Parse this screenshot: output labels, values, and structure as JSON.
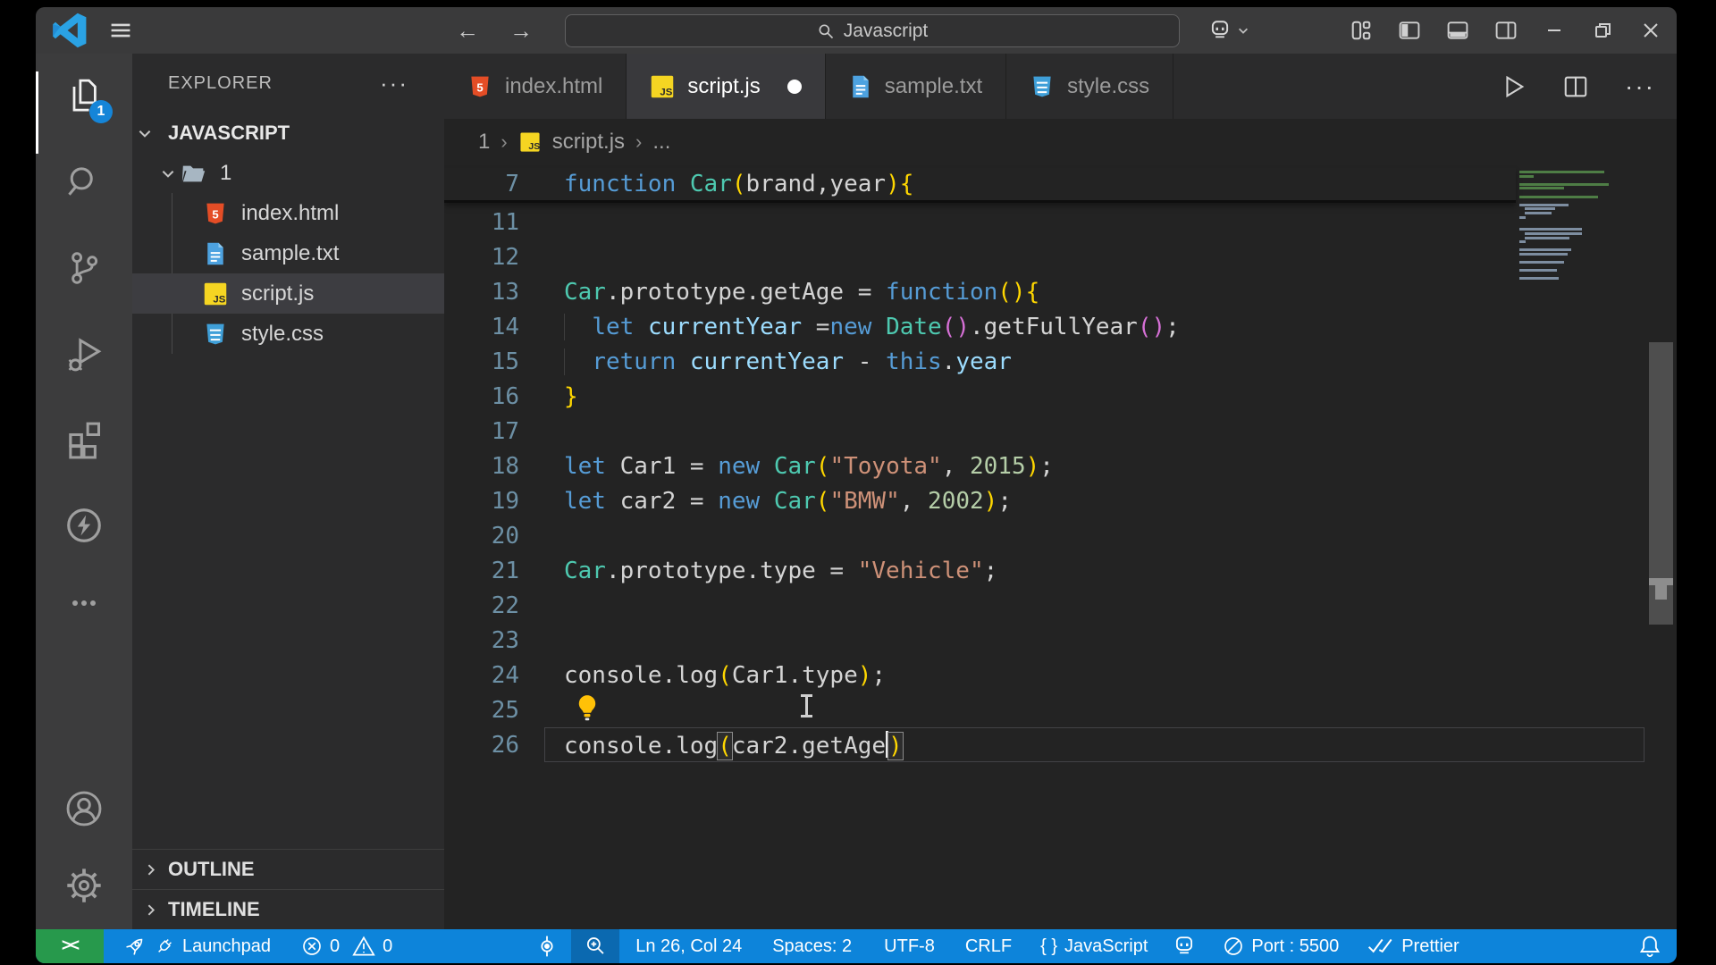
{
  "title_bar": {
    "search_value": "Javascript",
    "menu_icon": "hamburger",
    "nav_back": "←",
    "nav_forward": "→"
  },
  "activity_bar": {
    "explorer_badge": "1",
    "items": [
      "explorer",
      "search",
      "source-control",
      "run-debug",
      "extensions",
      "live-server",
      "more"
    ],
    "bottom_items": [
      "account",
      "settings"
    ]
  },
  "sidebar": {
    "title": "EXPLORER",
    "more": "···",
    "section": "JAVASCRIPT",
    "folder": "1",
    "files": [
      {
        "label": "index.html",
        "icon": "html",
        "selected": false
      },
      {
        "label": "sample.txt",
        "icon": "txt",
        "selected": false
      },
      {
        "label": "script.js",
        "icon": "js",
        "selected": true
      },
      {
        "label": "style.css",
        "icon": "css",
        "selected": false
      }
    ],
    "outline": "OUTLINE",
    "timeline": "TIMELINE"
  },
  "tabs": [
    {
      "label": "index.html",
      "icon": "html",
      "active": false,
      "dirty": false
    },
    {
      "label": "script.js",
      "icon": "js",
      "active": true,
      "dirty": true
    },
    {
      "label": "sample.txt",
      "icon": "txt",
      "active": false,
      "dirty": false
    },
    {
      "label": "style.css",
      "icon": "css",
      "active": false,
      "dirty": false
    }
  ],
  "breadcrumb": {
    "folder": "1",
    "file": "script.js",
    "more": "..."
  },
  "editor": {
    "lines": [
      {
        "num": "7",
        "sticky": true,
        "tokens": [
          [
            "kw",
            "function"
          ],
          [
            "pln",
            " "
          ],
          [
            "cls",
            "Car"
          ],
          [
            "b1",
            "("
          ],
          [
            "pln",
            "brand,year"
          ],
          [
            "b1",
            "){"
          ]
        ]
      },
      {
        "num": "11",
        "tokens": []
      },
      {
        "num": "12",
        "tokens": []
      },
      {
        "num": "13",
        "tokens": [
          [
            "cls",
            "Car"
          ],
          [
            "pln",
            ".prototype.getAge = "
          ],
          [
            "kw",
            "function"
          ],
          [
            "b1",
            "(){"
          ]
        ]
      },
      {
        "num": "14",
        "guide": true,
        "tokens": [
          [
            "pln",
            "  "
          ],
          [
            "kw",
            "let"
          ],
          [
            "pln",
            " "
          ],
          [
            "var",
            "currentYear"
          ],
          [
            "pln",
            " ="
          ],
          [
            "kw",
            "new"
          ],
          [
            "pln",
            " "
          ],
          [
            "cls",
            "Date"
          ],
          [
            "b2",
            "()"
          ],
          [
            "pln",
            ".getFullYear"
          ],
          [
            "b2",
            "()"
          ],
          [
            "pln",
            ";"
          ]
        ]
      },
      {
        "num": "15",
        "guide": true,
        "tokens": [
          [
            "pln",
            "  "
          ],
          [
            "kw",
            "return"
          ],
          [
            "pln",
            " "
          ],
          [
            "var",
            "currentYear"
          ],
          [
            "pln",
            " - "
          ],
          [
            "kw",
            "this"
          ],
          [
            "pln",
            "."
          ],
          [
            "var",
            "year"
          ]
        ]
      },
      {
        "num": "16",
        "tokens": [
          [
            "b1",
            "}"
          ]
        ]
      },
      {
        "num": "17",
        "tokens": []
      },
      {
        "num": "18",
        "tokens": [
          [
            "kw",
            "let"
          ],
          [
            "pln",
            " Car1 = "
          ],
          [
            "kw",
            "new"
          ],
          [
            "pln",
            " "
          ],
          [
            "cls",
            "Car"
          ],
          [
            "b1",
            "("
          ],
          [
            "str",
            "\"Toyota\""
          ],
          [
            "pln",
            ", "
          ],
          [
            "num",
            "2015"
          ],
          [
            "b1",
            ")"
          ],
          [
            "pln",
            ";"
          ]
        ]
      },
      {
        "num": "19",
        "tokens": [
          [
            "kw",
            "let"
          ],
          [
            "pln",
            " car2 = "
          ],
          [
            "kw",
            "new"
          ],
          [
            "pln",
            " "
          ],
          [
            "cls",
            "Car"
          ],
          [
            "b1",
            "("
          ],
          [
            "str",
            "\"BMW\""
          ],
          [
            "pln",
            ", "
          ],
          [
            "num",
            "2002"
          ],
          [
            "b1",
            ")"
          ],
          [
            "pln",
            ";"
          ]
        ]
      },
      {
        "num": "20",
        "tokens": []
      },
      {
        "num": "21",
        "tokens": [
          [
            "cls",
            "Car"
          ],
          [
            "pln",
            ".prototype.type = "
          ],
          [
            "str",
            "\"Vehicle\""
          ],
          [
            "pln",
            ";"
          ]
        ]
      },
      {
        "num": "22",
        "tokens": []
      },
      {
        "num": "23",
        "tokens": []
      },
      {
        "num": "24",
        "tokens": [
          [
            "pln",
            "console.log"
          ],
          [
            "b1",
            "("
          ],
          [
            "pln",
            "Car1.type"
          ],
          [
            "b1",
            ")"
          ],
          [
            "pln",
            ";"
          ]
        ]
      },
      {
        "num": "25",
        "bulb": true,
        "tokens": []
      },
      {
        "num": "26",
        "current": true,
        "tokens": [
          [
            "pln",
            "console.log"
          ],
          [
            "b1m",
            "("
          ],
          [
            "pln",
            "car2.getAge"
          ],
          [
            "caret",
            ""
          ],
          [
            "b1m",
            ")"
          ]
        ]
      }
    ],
    "minimap_rows": [
      [
        0,
        95,
        "c"
      ],
      [
        0,
        16,
        "c"
      ],
      null,
      [
        0,
        100,
        "c"
      ],
      [
        0,
        50,
        "c"
      ],
      null,
      [
        0,
        88,
        "c"
      ],
      null,
      [
        0,
        55,
        "k"
      ],
      [
        6,
        34,
        "k"
      ],
      [
        6,
        30,
        "k"
      ],
      [
        0,
        7,
        "k"
      ],
      null,
      null,
      [
        0,
        70,
        "k"
      ],
      [
        6,
        64,
        "k"
      ],
      [
        6,
        50,
        "k"
      ],
      [
        0,
        7,
        "k"
      ],
      null,
      [
        0,
        58,
        "k"
      ],
      [
        0,
        54,
        "k"
      ],
      null,
      [
        0,
        50,
        "k"
      ],
      null,
      [
        0,
        42,
        "k"
      ],
      null,
      [
        0,
        44,
        "k"
      ]
    ]
  },
  "editor_actions": {
    "more": "···"
  },
  "status_bar": {
    "launchpad": "Launchpad",
    "errors": "0",
    "warnings": "0",
    "line_col": "Ln 26, Col 24",
    "spaces": "Spaces: 2",
    "encoding": "UTF-8",
    "eol": "CRLF",
    "braces": "{ }",
    "language": "JavaScript",
    "port": "Port : 5500",
    "formatter": "Prettier",
    "remote_glyph": "><"
  },
  "colors": {
    "status_bar": "#0d84da",
    "remote": "#27994c",
    "badge": "#1585d8",
    "minimap_comment": "#4e7d45",
    "minimap_code": "#7d8da0",
    "syntax": {
      "keyword": "#569CD6",
      "class": "#4EC9B0",
      "bracket1": "#FFD700",
      "bracket2": "#D670D6",
      "string": "#CE9178",
      "number": "#B5CEA8",
      "variable": "#9CDCFE",
      "plain": "#d4d4d4"
    }
  }
}
